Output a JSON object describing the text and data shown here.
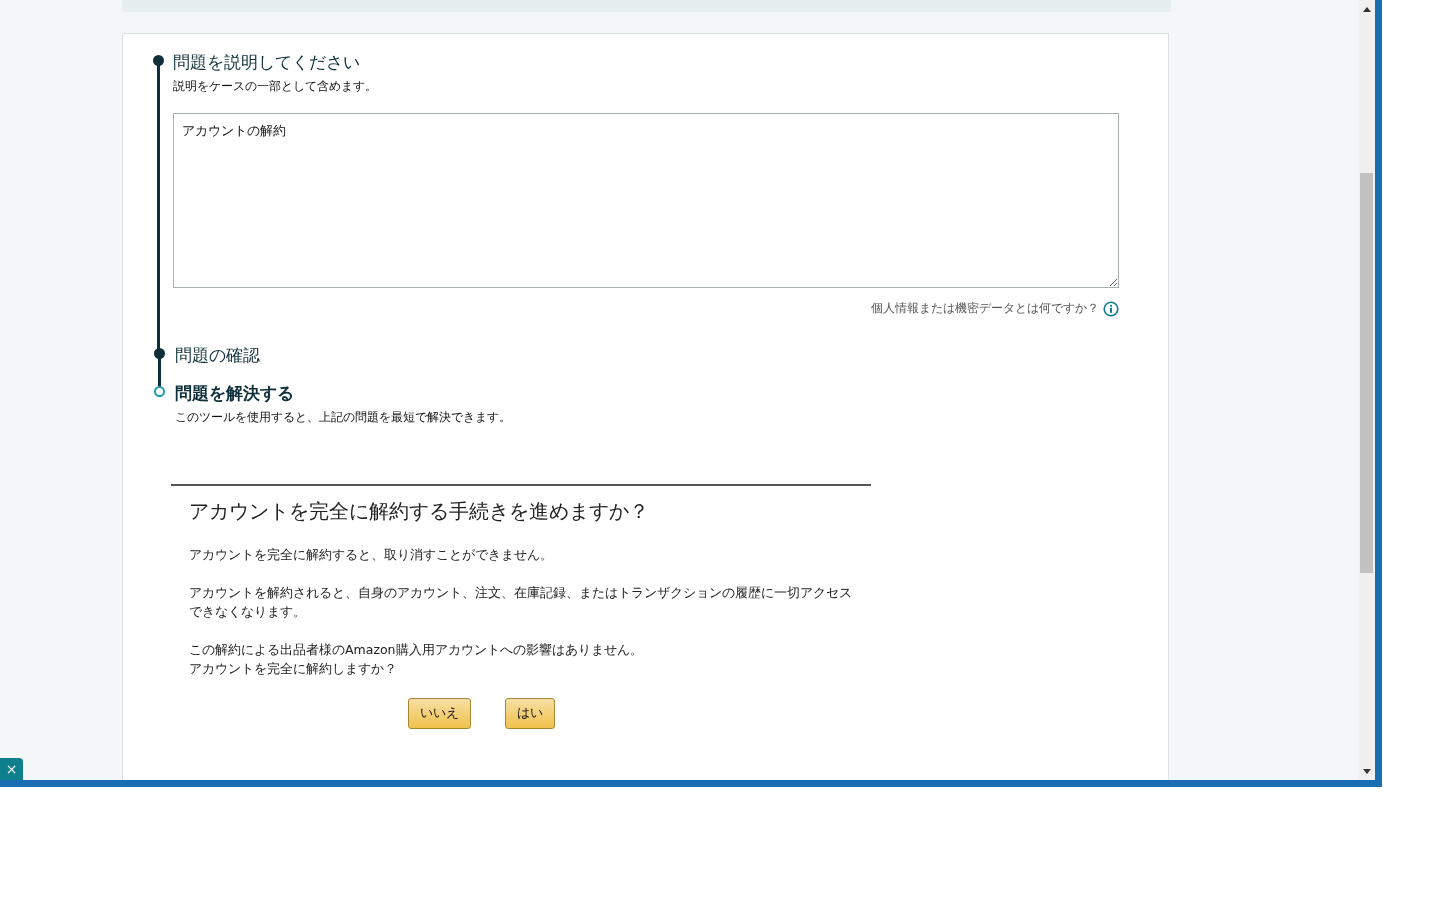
{
  "steps": [
    {
      "title": "問題を説明してください",
      "subtitle": "説明をケースの一部として含めます。",
      "completed": true,
      "textarea": {
        "value": "アカウントの解約"
      },
      "help_link": "個人情報または機密データとは何ですか？"
    },
    {
      "title": "問題の確認",
      "completed": true
    },
    {
      "title": "問題を解決する",
      "subtitle": "このツールを使用すると、上記の問題を最短で解決できます。",
      "completed": false
    }
  ],
  "dialog": {
    "title": "アカウントを完全に解約する手続きを進めますか？",
    "paragraphs": [
      [
        "アカウントを完全に解約すると、取り消すことができません。"
      ],
      [
        "アカウントを解約されると、自身のアカウント、注文、在庫記録、またはトランザクションの履歴に一切アクセスできなくなります。"
      ],
      [
        "この解約による出品者様のAmazon購入用アカウントへの影響はありません。",
        "アカウントを完全に解約しますか？"
      ]
    ],
    "buttons": [
      {
        "label": "いいえ"
      },
      {
        "label": "はい"
      }
    ]
  },
  "close_tab": {
    "label": "×"
  }
}
